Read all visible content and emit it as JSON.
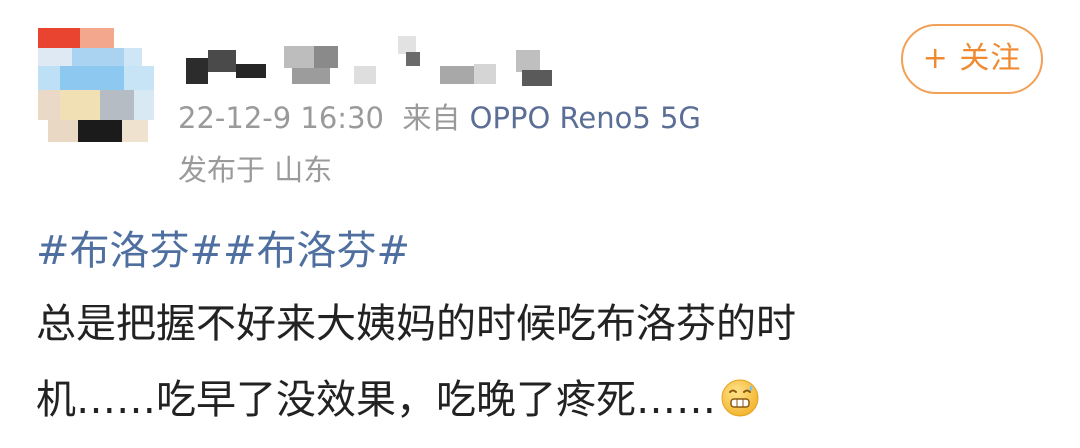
{
  "post": {
    "author": {
      "avatar_icon": "pixelated-avatar-icon",
      "name_icon": "pixelated-username"
    },
    "timestamp": "22-12-9 16:30",
    "source_prefix": "来自",
    "device": "OPPO Reno5 5G",
    "location": "发布于 山东",
    "follow_label": "+ 关注",
    "topics": [
      "#布洛芬#",
      "#布洛芬#"
    ],
    "text_line1": "总是把握不好来大姨妈的时候吃布洛芬的时",
    "text_line2": "机……吃早了没效果，吃晚了疼死……",
    "emoji_icon": "grimace-face-emoji-icon"
  },
  "colors": {
    "link": "#4e6f9f",
    "device": "#5b6e96",
    "meta": "#9a9a9a",
    "follow_accent": "#ef8a33",
    "text": "#222222"
  }
}
